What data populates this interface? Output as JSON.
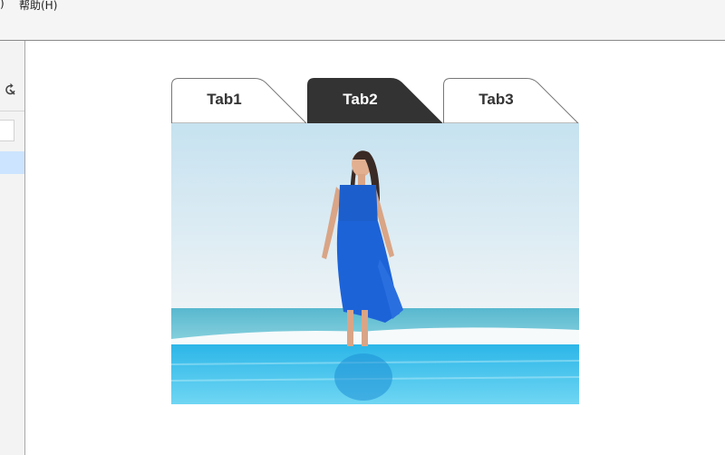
{
  "menubar": {
    "partial_menu": ")",
    "help_menu": "帮助(H)"
  },
  "tabs": [
    {
      "label": "Tab1",
      "active": false
    },
    {
      "label": "Tab2",
      "active": true
    },
    {
      "label": "Tab3",
      "active": false
    }
  ],
  "colors": {
    "active_tab": "#333333",
    "inactive_tab": "#ffffff",
    "tab_border": "#777777",
    "sidebar_selection": "#cce4ff"
  }
}
